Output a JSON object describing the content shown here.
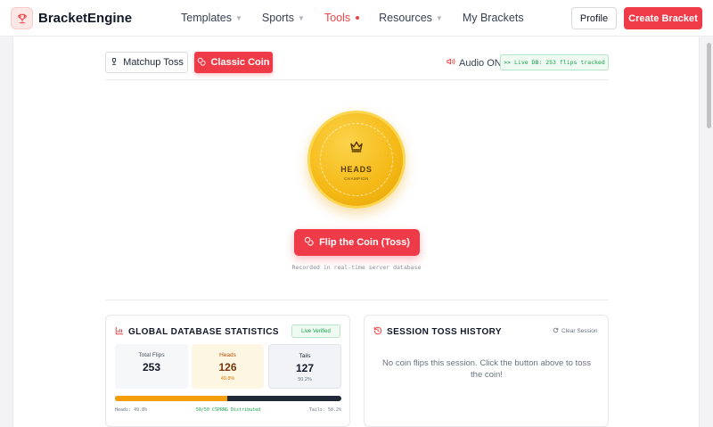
{
  "header": {
    "brand": "BracketEngine",
    "nav": [
      {
        "label": "Templates",
        "chevron": true,
        "active": false
      },
      {
        "label": "Sports",
        "chevron": true,
        "active": false
      },
      {
        "label": "Tools",
        "chevron": false,
        "active": true
      },
      {
        "label": "Resources",
        "chevron": true,
        "active": false
      },
      {
        "label": "My Brackets",
        "chevron": false,
        "active": false
      }
    ],
    "profile_label": "Profile",
    "create_label": "Create Bracket"
  },
  "modes": {
    "matchup_toss_label": "Matchup Toss",
    "classic_coin_label": "Classic Coin",
    "audio_label": "Audio ON",
    "live_db_label": ">> Live DB: 253 flips tracked"
  },
  "coin": {
    "face_label": "HEADS",
    "sub_label": "CHAMPION"
  },
  "flip": {
    "button_label": "Flip the Coin (Toss)",
    "caption": "Recorded in real-time server database"
  },
  "stats": {
    "title": "GLOBAL DATABASE STATISTICS",
    "verified_label": "Live Verified",
    "total": {
      "label": "Total Flips",
      "value": "253"
    },
    "heads": {
      "label": "Heads",
      "value": "126",
      "pct": "49.8%"
    },
    "tails": {
      "label": "Tails",
      "value": "127",
      "pct": "50.2%"
    },
    "heads_fraction": 0.498,
    "heads_caption": "Heads: 49.8%",
    "mid_caption": "50/50 CSPRNG Distributed",
    "tails_caption": "Tails: 50.2%"
  },
  "session": {
    "title": "SESSION TOSS HISTORY",
    "clear_label": "Clear Session",
    "empty_text": "No coin flips this session. Click the button above to toss the coin!"
  },
  "colors": {
    "accent": "#ef3b48",
    "coin_gold": "#f6bb1a",
    "success": "#16a34a",
    "heads_bar": "#f59e0b",
    "tails_bar": "#1f2937"
  },
  "icons": {
    "brand": "trophy-icon",
    "matchup_toss": "trophy-icon",
    "classic_coin": "coins-icon",
    "audio": "speaker-icon",
    "coin_face": "crown-icon",
    "flip": "coins-icon",
    "stats": "bar-chart-icon",
    "session": "history-icon",
    "clear": "refresh-icon"
  }
}
